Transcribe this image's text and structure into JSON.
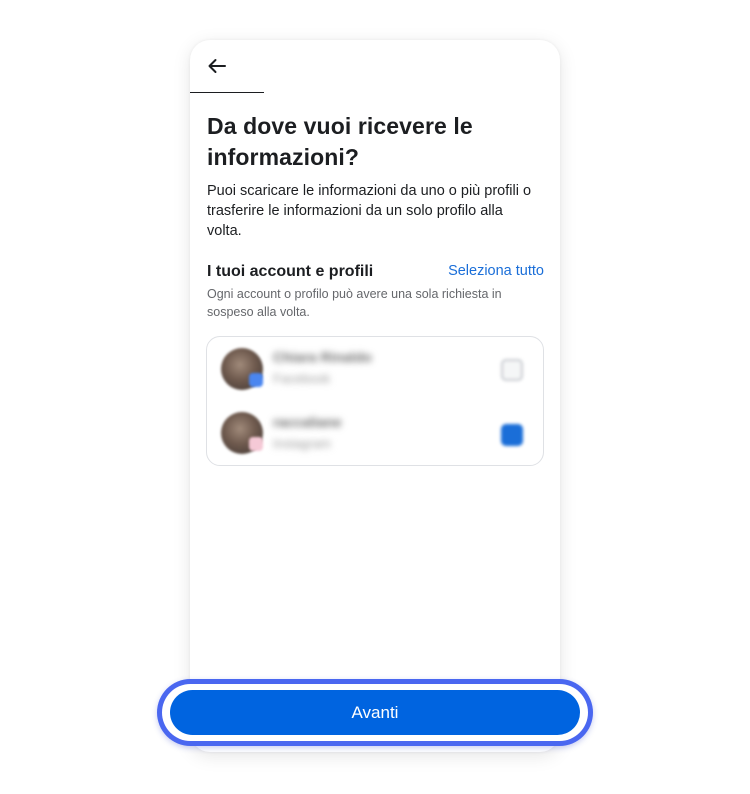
{
  "header": {
    "back_icon": "arrow-left-icon"
  },
  "main": {
    "title": "Da dove vuoi ricevere le informazioni?",
    "description": "Puoi scaricare le informazioni da uno o più profili o trasferire le informazioni da un solo profilo alla volta.",
    "section_title": "I tuoi account e profili",
    "select_all_label": "Seleziona tutto",
    "hint": "Ogni account o profilo può avere una sola richiesta in sospeso alla volta."
  },
  "accounts": [
    {
      "name": "Chiara Rinaldo",
      "platform": "Facebook",
      "selected": false
    },
    {
      "name": "raccaliane",
      "platform": "Instagram",
      "selected": true
    }
  ],
  "footer": {
    "next_label": "Avanti"
  },
  "colors": {
    "accent": "#0064e0",
    "link": "#1a6ed8",
    "highlight_ring": "#4a67f0"
  }
}
